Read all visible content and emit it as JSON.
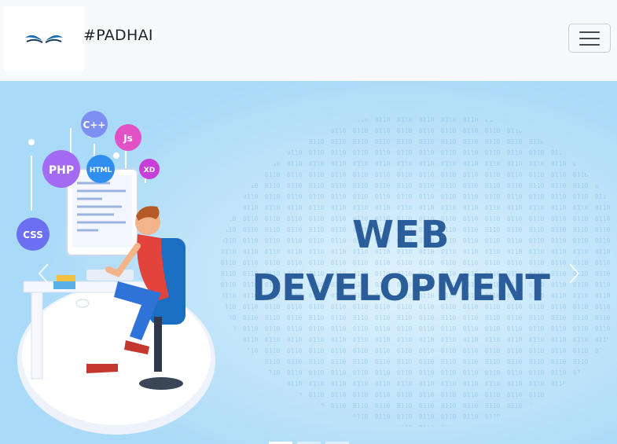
{
  "navbar": {
    "brand_text": "#PADHAI",
    "logo_icon": "open-book-logo-icon",
    "toggler_icon": "hamburger-menu-icon"
  },
  "carousel": {
    "slides": [
      {
        "title_line1": "WEB",
        "title_line2": "DEVELOPMENT",
        "bubbles": [
          "C++",
          "Js",
          "PHP",
          "HTML",
          "XD",
          "CSS"
        ]
      }
    ],
    "active_index": 0,
    "indicator_count": 3,
    "prev_icon": "chevron-left-icon",
    "next_icon": "chevron-right-icon"
  },
  "colors": {
    "banner_bg": "#a9daf7",
    "title_color": "#2b5d9a",
    "navbar_bg": "#f8f9fa"
  }
}
